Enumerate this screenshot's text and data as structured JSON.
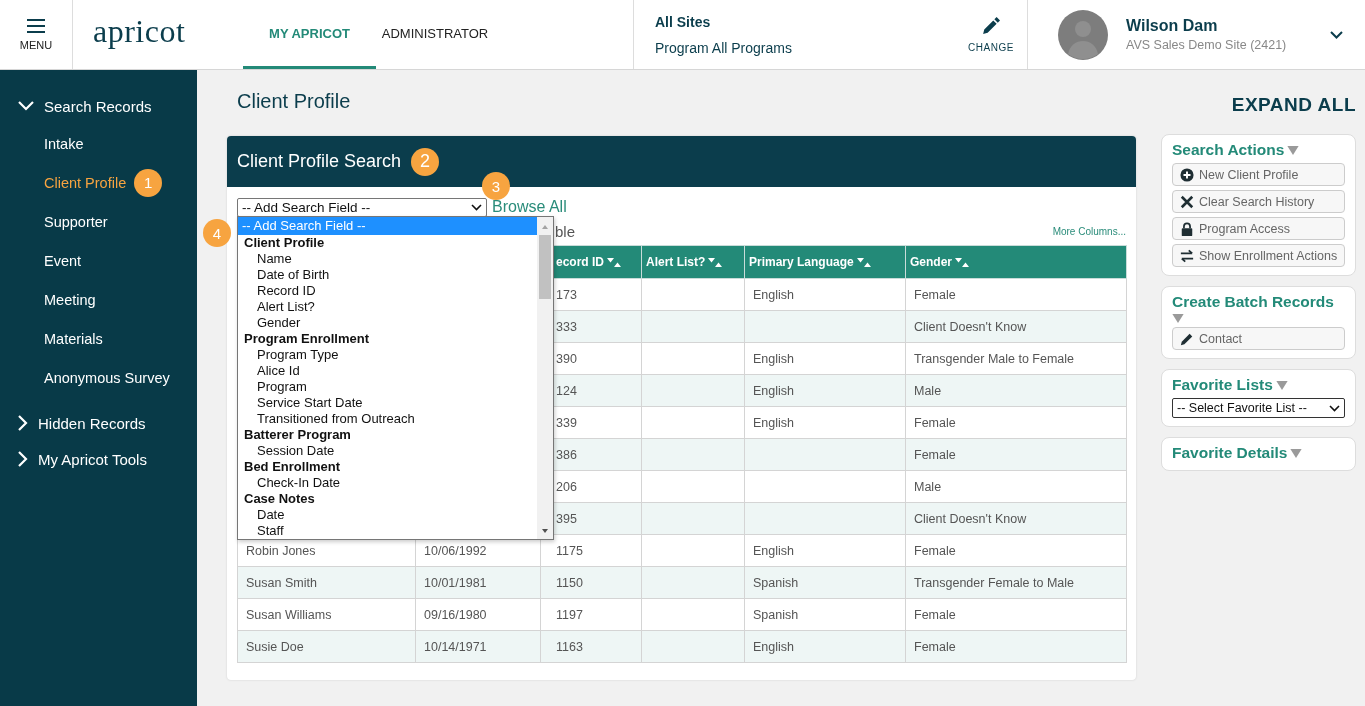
{
  "header": {
    "menu_label": "MENU",
    "logo": "apricot",
    "tabs": [
      {
        "label": "MY APRICOT",
        "selected": true
      },
      {
        "label": "ADMINISTRATOR",
        "selected": false
      }
    ],
    "site": {
      "title": "All Sites",
      "program": "Program All Programs"
    },
    "change_label": "CHANGE",
    "user": {
      "name": "Wilson Dam",
      "site": "AVS Sales Demo Site (2421)"
    }
  },
  "sidebar": {
    "items": [
      {
        "label": "Search Records",
        "expanded": true,
        "children": [
          {
            "label": "Intake",
            "selected": false
          },
          {
            "label": "Client Profile",
            "selected": true,
            "badge": "1"
          },
          {
            "label": "Supporter",
            "selected": false
          },
          {
            "label": "Event",
            "selected": false
          },
          {
            "label": "Meeting",
            "selected": false
          },
          {
            "label": "Materials",
            "selected": false
          },
          {
            "label": "Anonymous Survey",
            "selected": false
          }
        ]
      },
      {
        "label": "Hidden Records",
        "expanded": false
      },
      {
        "label": "My Apricot Tools",
        "expanded": false
      }
    ]
  },
  "page_title": "Client Profile",
  "search_card": {
    "title": "Client Profile Search",
    "title_badge": "2",
    "select_value": "-- Add Search Field --",
    "browse_all": "Browse All",
    "browse_badge": "3",
    "partial_label": "ble",
    "more_columns": "More Columns...",
    "dropdown": {
      "badge": "4",
      "options": [
        {
          "label": "-- Add Search Field --",
          "kind": "option",
          "selected": true
        },
        {
          "label": "Client Profile",
          "kind": "group",
          "selected": false
        },
        {
          "label": "Name",
          "kind": "option",
          "selected": false
        },
        {
          "label": "Date of Birth",
          "kind": "option",
          "selected": false
        },
        {
          "label": "Record ID",
          "kind": "option",
          "selected": false
        },
        {
          "label": "Alert List?",
          "kind": "option",
          "selected": false
        },
        {
          "label": "Gender",
          "kind": "option",
          "selected": false
        },
        {
          "label": "Program Enrollment",
          "kind": "group",
          "selected": false
        },
        {
          "label": "Program Type",
          "kind": "option",
          "selected": false
        },
        {
          "label": "Alice Id",
          "kind": "option",
          "selected": false
        },
        {
          "label": "Program",
          "kind": "option",
          "selected": false
        },
        {
          "label": "Service Start Date",
          "kind": "option",
          "selected": false
        },
        {
          "label": "Transitioned from Outreach",
          "kind": "option",
          "selected": false
        },
        {
          "label": "Batterer Program",
          "kind": "group",
          "selected": false
        },
        {
          "label": "Session Date",
          "kind": "option",
          "selected": false
        },
        {
          "label": "Bed Enrollment",
          "kind": "group",
          "selected": false
        },
        {
          "label": "Check-In Date",
          "kind": "option",
          "selected": false
        },
        {
          "label": "Case Notes",
          "kind": "group",
          "selected": false
        },
        {
          "label": "Date",
          "kind": "option",
          "selected": false
        },
        {
          "label": "Staff",
          "kind": "option",
          "selected": false
        }
      ]
    },
    "table": {
      "columns": [
        "ecord ID",
        "Alert List?",
        "Primary Language",
        "Gender"
      ],
      "rows": [
        {
          "record_id": "173",
          "language": "English",
          "gender": "Female"
        },
        {
          "record_id": "333",
          "gender": "Client Doesn't Know"
        },
        {
          "record_id": "390",
          "language": "English",
          "gender": "Transgender Male to Female"
        },
        {
          "record_id": "124",
          "language": "English",
          "gender": "Male"
        },
        {
          "record_id": "339",
          "language": "English",
          "gender": "Female"
        },
        {
          "record_id": "386",
          "gender": "Female"
        },
        {
          "record_id": "206",
          "gender": "Male"
        },
        {
          "record_id": "395",
          "gender": "Client Doesn't Know"
        },
        {
          "name": "Robin Jones",
          "dob": "10/06/1992",
          "record_id": "1175",
          "language": "English",
          "gender": "Female"
        },
        {
          "name": "Susan Smith",
          "dob": "10/01/1981",
          "record_id": "1150",
          "language": "Spanish",
          "gender": "Transgender Female to Male"
        },
        {
          "name": "Susan Williams",
          "dob": "09/16/1980",
          "record_id": "1197",
          "language": "Spanish",
          "gender": "Female"
        },
        {
          "name": "Susie Doe",
          "dob": "10/14/1971",
          "record_id": "1163",
          "language": "English",
          "gender": "Female"
        }
      ]
    }
  },
  "right_panel": {
    "expand_all": "EXPAND ALL",
    "panels": [
      {
        "title": "Search Actions",
        "buttons": [
          {
            "label": "New Client Profile",
            "kind": "add"
          },
          {
            "label": "Clear Search History",
            "kind": "clear"
          },
          {
            "label": "Program Access",
            "kind": "lock"
          },
          {
            "label": "Show Enrollment Actions",
            "kind": "swap"
          }
        ]
      },
      {
        "title": "Create Batch Records",
        "buttons": [
          {
            "label": "Contact",
            "kind": "edit"
          }
        ]
      },
      {
        "title": "Favorite Lists",
        "select": "-- Select Favorite List --"
      },
      {
        "title": "Favorite Details"
      }
    ]
  }
}
